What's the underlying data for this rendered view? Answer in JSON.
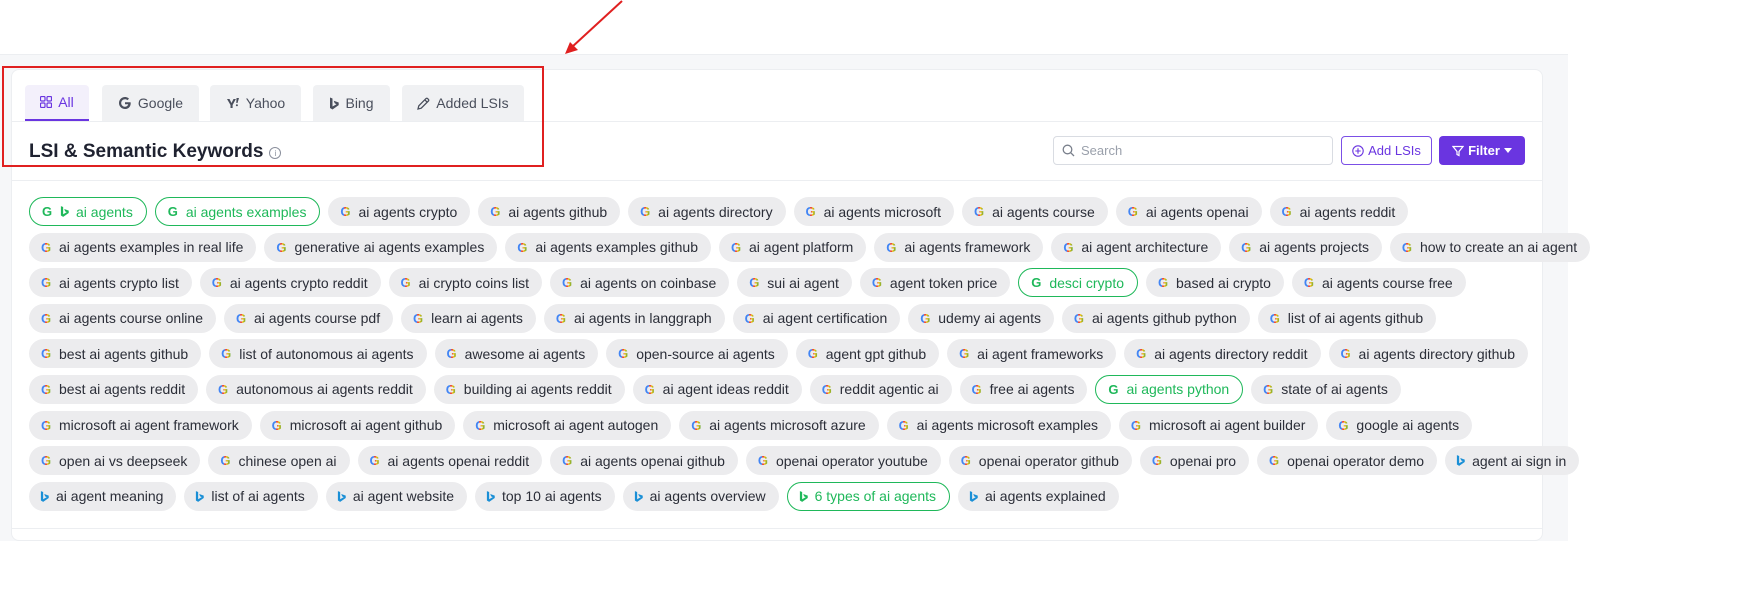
{
  "tabs": [
    {
      "label": "All",
      "icon": "grid-icon"
    },
    {
      "label": "Google",
      "icon": "google-icon"
    },
    {
      "label": "Yahoo",
      "icon": "yahoo-icon"
    },
    {
      "label": "Bing",
      "icon": "bing-icon"
    },
    {
      "label": "Added LSIs",
      "icon": "pencil-icon"
    }
  ],
  "header": {
    "title": "LSI & Semantic Keywords",
    "info_glyph": "i"
  },
  "search": {
    "placeholder": "Search"
  },
  "buttons": {
    "add_lsis": "Add LSIs",
    "filter": "Filter"
  },
  "colors": {
    "accent": "#6a35e0",
    "selected": "#1fb85a",
    "annotation": "#e02020"
  },
  "chip_rows": [
    [
      {
        "label": "ai agents",
        "engines": [
          "google",
          "bing"
        ],
        "selected": true
      },
      {
        "label": "ai agents examples",
        "engines": [
          "google"
        ],
        "selected": true
      },
      {
        "label": "ai agents crypto",
        "engines": [
          "google"
        ],
        "selected": false
      },
      {
        "label": "ai agents github",
        "engines": [
          "google"
        ],
        "selected": false
      },
      {
        "label": "ai agents directory",
        "engines": [
          "google"
        ],
        "selected": false
      },
      {
        "label": "ai agents microsoft",
        "engines": [
          "google"
        ],
        "selected": false
      },
      {
        "label": "ai agents course",
        "engines": [
          "google"
        ],
        "selected": false
      },
      {
        "label": "ai agents openai",
        "engines": [
          "google"
        ],
        "selected": false
      },
      {
        "label": "ai agents reddit",
        "engines": [
          "google"
        ],
        "selected": false
      }
    ],
    [
      {
        "label": "ai agents examples in real life",
        "engines": [
          "google"
        ],
        "selected": false
      },
      {
        "label": "generative ai agents examples",
        "engines": [
          "google"
        ],
        "selected": false
      },
      {
        "label": "ai agents examples github",
        "engines": [
          "google"
        ],
        "selected": false
      },
      {
        "label": "ai agent platform",
        "engines": [
          "google"
        ],
        "selected": false
      },
      {
        "label": "ai agents framework",
        "engines": [
          "google"
        ],
        "selected": false
      },
      {
        "label": "ai agent architecture",
        "engines": [
          "google"
        ],
        "selected": false
      },
      {
        "label": "ai agents projects",
        "engines": [
          "google"
        ],
        "selected": false
      },
      {
        "label": "how to create an ai agent",
        "engines": [
          "google"
        ],
        "selected": false
      }
    ],
    [
      {
        "label": "ai agents crypto list",
        "engines": [
          "google"
        ],
        "selected": false
      },
      {
        "label": "ai agents crypto reddit",
        "engines": [
          "google"
        ],
        "selected": false
      },
      {
        "label": "ai crypto coins list",
        "engines": [
          "google"
        ],
        "selected": false
      },
      {
        "label": "ai agents on coinbase",
        "engines": [
          "google"
        ],
        "selected": false
      },
      {
        "label": "sui ai agent",
        "engines": [
          "google"
        ],
        "selected": false
      },
      {
        "label": "agent token price",
        "engines": [
          "google"
        ],
        "selected": false
      },
      {
        "label": "desci crypto",
        "engines": [
          "google"
        ],
        "selected": true
      },
      {
        "label": "based ai crypto",
        "engines": [
          "google"
        ],
        "selected": false
      },
      {
        "label": "ai agents course free",
        "engines": [
          "google"
        ],
        "selected": false
      }
    ],
    [
      {
        "label": "ai agents course online",
        "engines": [
          "google"
        ],
        "selected": false
      },
      {
        "label": "ai agents course pdf",
        "engines": [
          "google"
        ],
        "selected": false
      },
      {
        "label": "learn ai agents",
        "engines": [
          "google"
        ],
        "selected": false
      },
      {
        "label": "ai agents in langgraph",
        "engines": [
          "google"
        ],
        "selected": false
      },
      {
        "label": "ai agent certification",
        "engines": [
          "google"
        ],
        "selected": false
      },
      {
        "label": "udemy ai agents",
        "engines": [
          "google"
        ],
        "selected": false
      },
      {
        "label": "ai agents github python",
        "engines": [
          "google"
        ],
        "selected": false
      },
      {
        "label": "list of ai agents github",
        "engines": [
          "google"
        ],
        "selected": false
      }
    ],
    [
      {
        "label": "best ai agents github",
        "engines": [
          "google"
        ],
        "selected": false
      },
      {
        "label": "list of autonomous ai agents",
        "engines": [
          "google"
        ],
        "selected": false
      },
      {
        "label": "awesome ai agents",
        "engines": [
          "google"
        ],
        "selected": false
      },
      {
        "label": "open-source ai agents",
        "engines": [
          "google"
        ],
        "selected": false
      },
      {
        "label": "agent gpt github",
        "engines": [
          "google"
        ],
        "selected": false
      },
      {
        "label": "ai agent frameworks",
        "engines": [
          "google"
        ],
        "selected": false
      },
      {
        "label": "ai agents directory reddit",
        "engines": [
          "google"
        ],
        "selected": false
      },
      {
        "label": "ai agents directory github",
        "engines": [
          "google"
        ],
        "selected": false
      }
    ],
    [
      {
        "label": "best ai agents reddit",
        "engines": [
          "google"
        ],
        "selected": false
      },
      {
        "label": "autonomous ai agents reddit",
        "engines": [
          "google"
        ],
        "selected": false
      },
      {
        "label": "building ai agents reddit",
        "engines": [
          "google"
        ],
        "selected": false
      },
      {
        "label": "ai agent ideas reddit",
        "engines": [
          "google"
        ],
        "selected": false
      },
      {
        "label": "reddit agentic ai",
        "engines": [
          "google"
        ],
        "selected": false
      },
      {
        "label": "free ai agents",
        "engines": [
          "google"
        ],
        "selected": false
      },
      {
        "label": "ai agents python",
        "engines": [
          "google"
        ],
        "selected": true
      },
      {
        "label": "state of ai agents",
        "engines": [
          "google"
        ],
        "selected": false
      }
    ],
    [
      {
        "label": "microsoft ai agent framework",
        "engines": [
          "google"
        ],
        "selected": false
      },
      {
        "label": "microsoft ai agent github",
        "engines": [
          "google"
        ],
        "selected": false
      },
      {
        "label": "microsoft ai agent autogen",
        "engines": [
          "google"
        ],
        "selected": false
      },
      {
        "label": "ai agents microsoft azure",
        "engines": [
          "google"
        ],
        "selected": false
      },
      {
        "label": "ai agents microsoft examples",
        "engines": [
          "google"
        ],
        "selected": false
      },
      {
        "label": "microsoft ai agent builder",
        "engines": [
          "google"
        ],
        "selected": false
      },
      {
        "label": "google ai agents",
        "engines": [
          "google"
        ],
        "selected": false
      }
    ],
    [
      {
        "label": "open ai vs deepseek",
        "engines": [
          "google"
        ],
        "selected": false
      },
      {
        "label": "chinese open ai",
        "engines": [
          "google"
        ],
        "selected": false
      },
      {
        "label": "ai agents openai reddit",
        "engines": [
          "google"
        ],
        "selected": false
      },
      {
        "label": "ai agents openai github",
        "engines": [
          "google"
        ],
        "selected": false
      },
      {
        "label": "openai operator youtube",
        "engines": [
          "google"
        ],
        "selected": false
      },
      {
        "label": "openai operator github",
        "engines": [
          "google"
        ],
        "selected": false
      },
      {
        "label": "openai pro",
        "engines": [
          "google"
        ],
        "selected": false
      },
      {
        "label": "openai operator demo",
        "engines": [
          "google"
        ],
        "selected": false
      },
      {
        "label": "agent ai sign in",
        "engines": [
          "bing"
        ],
        "selected": false
      }
    ],
    [
      {
        "label": "ai agent meaning",
        "engines": [
          "bing"
        ],
        "selected": false
      },
      {
        "label": "list of ai agents",
        "engines": [
          "bing"
        ],
        "selected": false
      },
      {
        "label": "ai agent website",
        "engines": [
          "bing"
        ],
        "selected": false
      },
      {
        "label": "top 10 ai agents",
        "engines": [
          "bing"
        ],
        "selected": false
      },
      {
        "label": "ai agents overview",
        "engines": [
          "bing"
        ],
        "selected": false
      },
      {
        "label": "6 types of ai agents",
        "engines": [
          "bing"
        ],
        "selected": true
      },
      {
        "label": "ai agents explained",
        "engines": [
          "bing"
        ],
        "selected": false
      }
    ]
  ]
}
